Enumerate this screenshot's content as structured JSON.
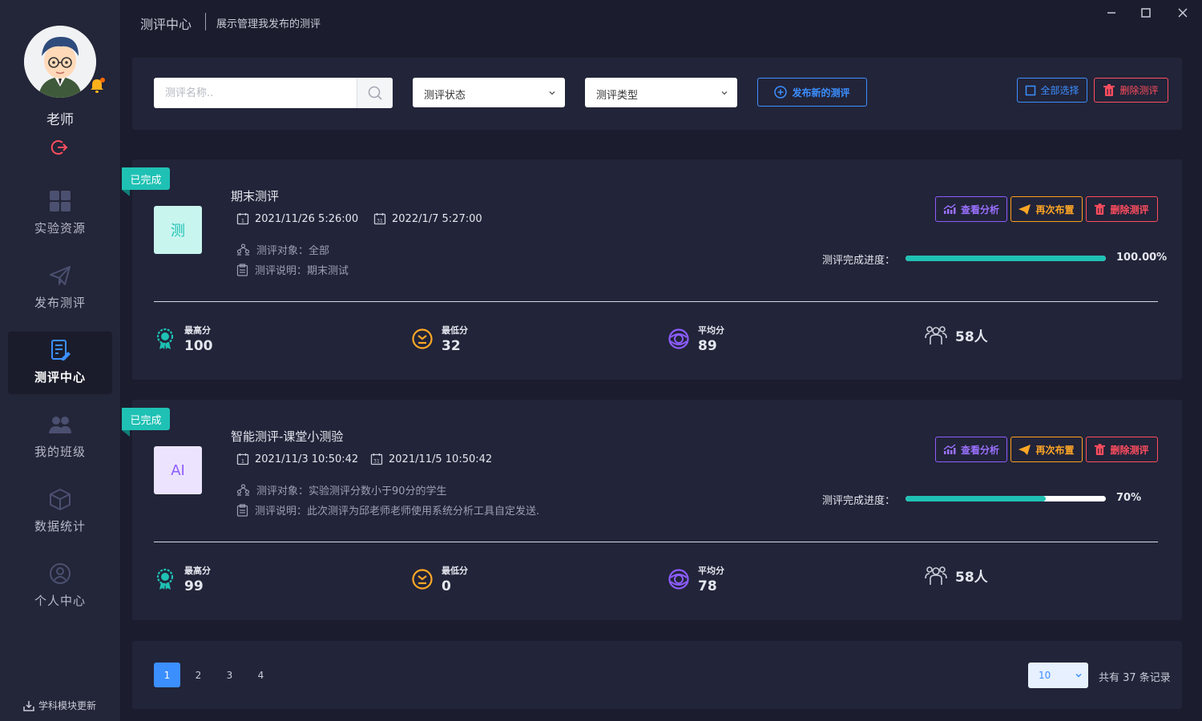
{
  "sidebar": {
    "username": "老师",
    "nav": [
      {
        "label": "实验资源",
        "icon": "grid-icon"
      },
      {
        "label": "发布测评",
        "icon": "paper-plane-icon"
      },
      {
        "label": "测评中心",
        "icon": "document-edit-icon",
        "active": true
      },
      {
        "label": "我的班级",
        "icon": "users-icon"
      },
      {
        "label": "数据统计",
        "icon": "cube-icon"
      },
      {
        "label": "个人中心",
        "icon": "user-circle-icon"
      }
    ],
    "update_label": "学科模块更新"
  },
  "header": {
    "title": "测评中心",
    "subtitle": "展示管理我发布的测评"
  },
  "filters": {
    "search_placeholder": "测评名称..",
    "status_select": "测评状态",
    "type_select": "测评类型",
    "publish_label": "发布新的测评",
    "select_all_label": "全部选择",
    "delete_label": "删除测评"
  },
  "cards": [
    {
      "status": "已完成",
      "thumb": "测",
      "title": "期末测评",
      "start": "2021/11/26 5:26:00",
      "end": "2022/1/7 5:27:00",
      "target": "测评对象：全部",
      "desc": "测评说明：期末测试",
      "analyze_label": "查看分析",
      "redo_label": "再次布置",
      "delete_label": "删除测评",
      "progress_label": "测评完成进度：",
      "progress_text": "100.00%",
      "progress": 1.0,
      "stats": {
        "max_label": "最高分",
        "max": "100",
        "min_label": "最低分",
        "min": "32",
        "avg_label": "平均分",
        "avg": "89",
        "people": "58人"
      }
    },
    {
      "status": "已完成",
      "thumb": "AI",
      "title": "智能测评-课堂小测验",
      "start": "2021/11/3 10:50:42",
      "end": "2021/11/5 10:50:42",
      "target": "测评对象：实验测评分数小于90分的学生",
      "desc": "测评说明：此次测评为邱老师老师使用系统分析工具自定发送.",
      "analyze_label": "查看分析",
      "redo_label": "再次布置",
      "delete_label": "删除测评",
      "progress_label": "测评完成进度：",
      "progress_text": "70%",
      "progress": 0.7,
      "stats": {
        "max_label": "最高分",
        "max": "99",
        "min_label": "最低分",
        "min": "0",
        "avg_label": "平均分",
        "avg": "78",
        "people": "58人"
      }
    }
  ],
  "pagination": {
    "pages": [
      "1",
      "2",
      "3",
      "4"
    ],
    "current": "1",
    "page_size": "10",
    "total_text": "共有 37 条记录"
  },
  "colors": {
    "accent_blue": "#3c8fff",
    "teal": "#1fc1b4",
    "danger": "#ff4d5e",
    "orange": "#ffa726",
    "purple": "#8d5cff",
    "bg": "#1b1d2e",
    "panel": "#222439"
  }
}
